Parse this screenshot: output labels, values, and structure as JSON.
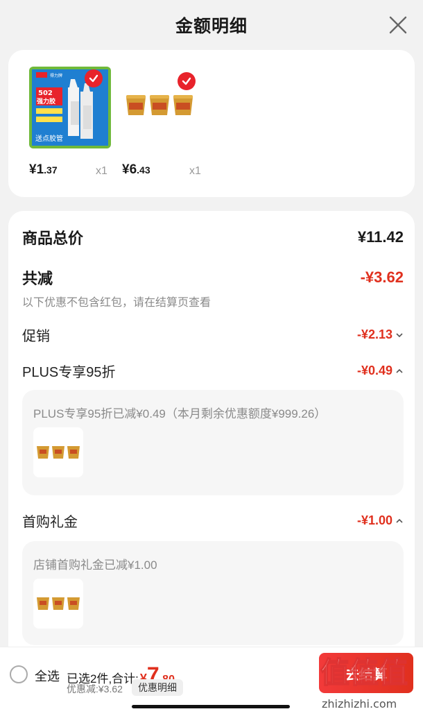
{
  "header": {
    "title": "金额明细"
  },
  "products": [
    {
      "price_int": "¥1",
      "price_dec": ".37",
      "qty": "x1",
      "label_lines": [
        "502",
        "强力胶"
      ],
      "tag": "送点胶管",
      "brand": "得力牌"
    },
    {
      "price_int": "¥6",
      "price_dec": ".43",
      "qty": "x1"
    }
  ],
  "summary": {
    "total_label": "商品总价",
    "total_value": "¥11.42",
    "reduce_label": "共减",
    "reduce_value": "-¥3.62",
    "note": "以下优惠不包含红包，请在结算页查看"
  },
  "promo": {
    "label": "促销",
    "value": "-¥2.13"
  },
  "plus": {
    "label": "PLUS专享95折",
    "value": "-¥0.49",
    "detail": "PLUS专享95折已减¥0.49（本月剩余优惠额度¥999.26）"
  },
  "first_gift": {
    "label": "首购礼金",
    "value": "-¥1.00",
    "detail": "店铺首购礼金已减¥1.00"
  },
  "bottom": {
    "select_all": "全选",
    "selected": "已选2件,合计:",
    "currency": "¥",
    "total_int": "7",
    "total_dec": ".80",
    "discount": "优惠减:¥3.62",
    "detail_btn": "优惠明细",
    "checkout": "去结算"
  },
  "watermark": {
    "site": "zhizhizhi.com",
    "brand": "值值值"
  },
  "colors": {
    "accent": "#e0301e",
    "check": "#e8232b"
  }
}
